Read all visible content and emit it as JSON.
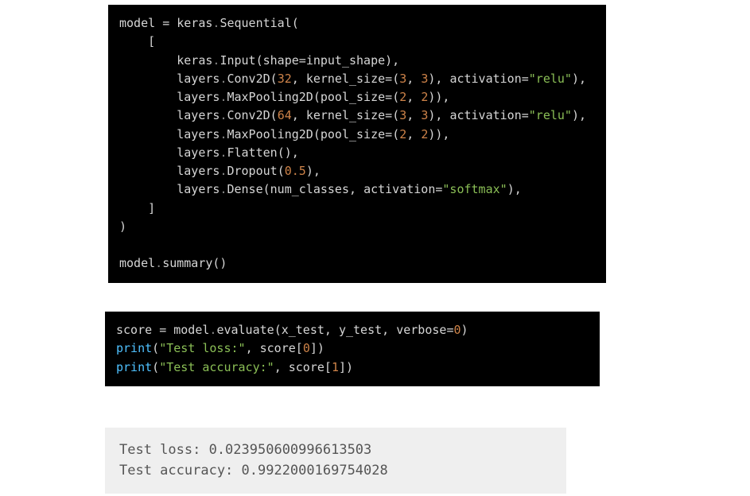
{
  "code_block_1": {
    "tokens": [
      [
        {
          "t": "model ",
          "c": "tk-name"
        },
        {
          "t": "=",
          "c": "tk-op"
        },
        {
          "t": " keras",
          "c": "tk-name"
        },
        {
          "t": ".",
          "c": "tk-dot"
        },
        {
          "t": "Sequential",
          "c": "tk-name"
        },
        {
          "t": "(",
          "c": "tk-punc"
        }
      ],
      [
        {
          "t": "    [",
          "c": "tk-punc"
        }
      ],
      [
        {
          "t": "        keras",
          "c": "tk-name"
        },
        {
          "t": ".",
          "c": "tk-dot"
        },
        {
          "t": "Input",
          "c": "tk-name"
        },
        {
          "t": "(",
          "c": "tk-punc"
        },
        {
          "t": "shape",
          "c": "tk-param"
        },
        {
          "t": "=",
          "c": "tk-op"
        },
        {
          "t": "input_shape",
          "c": "tk-name"
        },
        {
          "t": "),",
          "c": "tk-punc"
        }
      ],
      [
        {
          "t": "        layers",
          "c": "tk-name"
        },
        {
          "t": ".",
          "c": "tk-dot"
        },
        {
          "t": "Conv2D",
          "c": "tk-name"
        },
        {
          "t": "(",
          "c": "tk-punc"
        },
        {
          "t": "32",
          "c": "tk-num"
        },
        {
          "t": ", ",
          "c": "tk-punc"
        },
        {
          "t": "kernel_size",
          "c": "tk-param"
        },
        {
          "t": "=",
          "c": "tk-op"
        },
        {
          "t": "(",
          "c": "tk-punc"
        },
        {
          "t": "3",
          "c": "tk-num"
        },
        {
          "t": ", ",
          "c": "tk-punc"
        },
        {
          "t": "3",
          "c": "tk-num"
        },
        {
          "t": "), ",
          "c": "tk-punc"
        },
        {
          "t": "activation",
          "c": "tk-param"
        },
        {
          "t": "=",
          "c": "tk-op"
        },
        {
          "t": "\"relu\"",
          "c": "tk-str"
        },
        {
          "t": "),",
          "c": "tk-punc"
        }
      ],
      [
        {
          "t": "        layers",
          "c": "tk-name"
        },
        {
          "t": ".",
          "c": "tk-dot"
        },
        {
          "t": "MaxPooling2D",
          "c": "tk-name"
        },
        {
          "t": "(",
          "c": "tk-punc"
        },
        {
          "t": "pool_size",
          "c": "tk-param"
        },
        {
          "t": "=",
          "c": "tk-op"
        },
        {
          "t": "(",
          "c": "tk-punc"
        },
        {
          "t": "2",
          "c": "tk-num"
        },
        {
          "t": ", ",
          "c": "tk-punc"
        },
        {
          "t": "2",
          "c": "tk-num"
        },
        {
          "t": ")),",
          "c": "tk-punc"
        }
      ],
      [
        {
          "t": "        layers",
          "c": "tk-name"
        },
        {
          "t": ".",
          "c": "tk-dot"
        },
        {
          "t": "Conv2D",
          "c": "tk-name"
        },
        {
          "t": "(",
          "c": "tk-punc"
        },
        {
          "t": "64",
          "c": "tk-num"
        },
        {
          "t": ", ",
          "c": "tk-punc"
        },
        {
          "t": "kernel_size",
          "c": "tk-param"
        },
        {
          "t": "=",
          "c": "tk-op"
        },
        {
          "t": "(",
          "c": "tk-punc"
        },
        {
          "t": "3",
          "c": "tk-num"
        },
        {
          "t": ", ",
          "c": "tk-punc"
        },
        {
          "t": "3",
          "c": "tk-num"
        },
        {
          "t": "), ",
          "c": "tk-punc"
        },
        {
          "t": "activation",
          "c": "tk-param"
        },
        {
          "t": "=",
          "c": "tk-op"
        },
        {
          "t": "\"relu\"",
          "c": "tk-str"
        },
        {
          "t": "),",
          "c": "tk-punc"
        }
      ],
      [
        {
          "t": "        layers",
          "c": "tk-name"
        },
        {
          "t": ".",
          "c": "tk-dot"
        },
        {
          "t": "MaxPooling2D",
          "c": "tk-name"
        },
        {
          "t": "(",
          "c": "tk-punc"
        },
        {
          "t": "pool_size",
          "c": "tk-param"
        },
        {
          "t": "=",
          "c": "tk-op"
        },
        {
          "t": "(",
          "c": "tk-punc"
        },
        {
          "t": "2",
          "c": "tk-num"
        },
        {
          "t": ", ",
          "c": "tk-punc"
        },
        {
          "t": "2",
          "c": "tk-num"
        },
        {
          "t": ")),",
          "c": "tk-punc"
        }
      ],
      [
        {
          "t": "        layers",
          "c": "tk-name"
        },
        {
          "t": ".",
          "c": "tk-dot"
        },
        {
          "t": "Flatten",
          "c": "tk-name"
        },
        {
          "t": "(),",
          "c": "tk-punc"
        }
      ],
      [
        {
          "t": "        layers",
          "c": "tk-name"
        },
        {
          "t": ".",
          "c": "tk-dot"
        },
        {
          "t": "Dropout",
          "c": "tk-name"
        },
        {
          "t": "(",
          "c": "tk-punc"
        },
        {
          "t": "0.5",
          "c": "tk-num"
        },
        {
          "t": "),",
          "c": "tk-punc"
        }
      ],
      [
        {
          "t": "        layers",
          "c": "tk-name"
        },
        {
          "t": ".",
          "c": "tk-dot"
        },
        {
          "t": "Dense",
          "c": "tk-name"
        },
        {
          "t": "(",
          "c": "tk-punc"
        },
        {
          "t": "num_classes",
          "c": "tk-name"
        },
        {
          "t": ", ",
          "c": "tk-punc"
        },
        {
          "t": "activation",
          "c": "tk-param"
        },
        {
          "t": "=",
          "c": "tk-op"
        },
        {
          "t": "\"softmax\"",
          "c": "tk-str"
        },
        {
          "t": "),",
          "c": "tk-punc"
        }
      ],
      [
        {
          "t": "    ]",
          "c": "tk-punc"
        }
      ],
      [
        {
          "t": ")",
          "c": "tk-punc"
        }
      ],
      [
        {
          "t": "",
          "c": "tk-punc"
        }
      ],
      [
        {
          "t": "model",
          "c": "tk-name"
        },
        {
          "t": ".",
          "c": "tk-dot"
        },
        {
          "t": "summary",
          "c": "tk-name"
        },
        {
          "t": "()",
          "c": "tk-punc"
        }
      ]
    ]
  },
  "code_block_2": {
    "tokens": [
      [
        {
          "t": "score ",
          "c": "tk-name"
        },
        {
          "t": "=",
          "c": "tk-op"
        },
        {
          "t": " model",
          "c": "tk-name"
        },
        {
          "t": ".",
          "c": "tk-dot"
        },
        {
          "t": "evaluate",
          "c": "tk-name"
        },
        {
          "t": "(",
          "c": "tk-punc"
        },
        {
          "t": "x_test",
          "c": "tk-name"
        },
        {
          "t": ", ",
          "c": "tk-punc"
        },
        {
          "t": "y_test",
          "c": "tk-name"
        },
        {
          "t": ", ",
          "c": "tk-punc"
        },
        {
          "t": "verbose",
          "c": "tk-param"
        },
        {
          "t": "=",
          "c": "tk-op"
        },
        {
          "t": "0",
          "c": "tk-num"
        },
        {
          "t": ")",
          "c": "tk-punc"
        }
      ],
      [
        {
          "t": "print",
          "c": "tk-fn"
        },
        {
          "t": "(",
          "c": "tk-punc"
        },
        {
          "t": "\"Test loss:\"",
          "c": "tk-str"
        },
        {
          "t": ", ",
          "c": "tk-punc"
        },
        {
          "t": "score",
          "c": "tk-name"
        },
        {
          "t": "[",
          "c": "tk-punc"
        },
        {
          "t": "0",
          "c": "tk-num"
        },
        {
          "t": "])",
          "c": "tk-punc"
        }
      ],
      [
        {
          "t": "print",
          "c": "tk-fn"
        },
        {
          "t": "(",
          "c": "tk-punc"
        },
        {
          "t": "\"Test accuracy:\"",
          "c": "tk-str"
        },
        {
          "t": ", ",
          "c": "tk-punc"
        },
        {
          "t": "score",
          "c": "tk-name"
        },
        {
          "t": "[",
          "c": "tk-punc"
        },
        {
          "t": "1",
          "c": "tk-num"
        },
        {
          "t": "])",
          "c": "tk-punc"
        }
      ]
    ]
  },
  "output_block": {
    "lines": [
      "Test loss: 0.023950600996613503",
      "Test accuracy: 0.9922000169754028"
    ]
  }
}
